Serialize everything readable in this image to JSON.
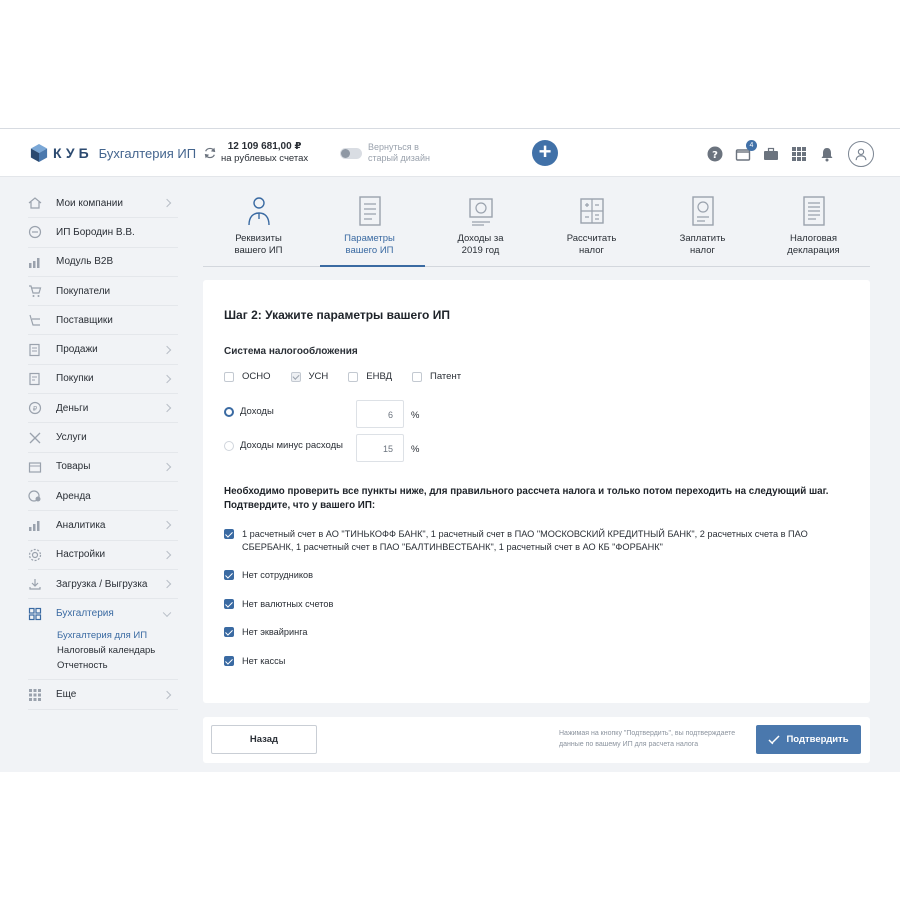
{
  "header": {
    "logo_text": "КУБ",
    "logo_sub": "Бухгалтерия ИП",
    "balance_amount": "12 109 681,00 ₽",
    "balance_label": "на рублевых счетах",
    "old_design_line1": "Вернуться в",
    "old_design_line2": "старый дизайн",
    "notifications_count": "4",
    "plus_label": "+"
  },
  "sidebar": {
    "items": [
      {
        "label": "Мои компании",
        "icon": "home-icon"
      },
      {
        "label": "ИП Бородин В.В.",
        "icon": "company-icon"
      },
      {
        "label": "Модуль B2B",
        "icon": "b2b-icon"
      },
      {
        "label": "Покупатели",
        "icon": "cart-icon"
      },
      {
        "label": "Поставщики",
        "icon": "supplier-icon"
      },
      {
        "label": "Продажи",
        "icon": "sales-icon"
      },
      {
        "label": "Покупки",
        "icon": "purchases-icon"
      },
      {
        "label": "Деньги",
        "icon": "money-icon"
      },
      {
        "label": "Услуги",
        "icon": "services-icon"
      },
      {
        "label": "Товары",
        "icon": "goods-icon"
      },
      {
        "label": "Аренда",
        "icon": "rent-icon"
      },
      {
        "label": "Аналитика",
        "icon": "analytics-icon"
      },
      {
        "label": "Настройки",
        "icon": "gear-icon"
      },
      {
        "label": "Загрузка / Выгрузка",
        "icon": "upload-icon"
      },
      {
        "label": "Бухгалтерия",
        "icon": "accounting-icon"
      },
      {
        "label": "Еще",
        "icon": "grid-icon"
      }
    ],
    "sub_items": [
      "Бухгалтерия для ИП",
      "Налоговый календарь",
      "Отчетность"
    ]
  },
  "steps": [
    {
      "line1": "Реквизиты",
      "line2": "вашего ИП"
    },
    {
      "line1": "Параметры",
      "line2": "вашего ИП"
    },
    {
      "line1": "Доходы за",
      "line2": "2019 год"
    },
    {
      "line1": "Рассчитать",
      "line2": "налог"
    },
    {
      "line1": "Заплатить",
      "line2": "налог"
    },
    {
      "line1": "Налоговая",
      "line2": "декларация"
    }
  ],
  "form": {
    "title": "Шаг 2: Укажите параметры вашего ИП",
    "tax_system_label": "Система налогообложения",
    "tax_options": [
      "ОСНО",
      "УСН",
      "ЕНВД",
      "Патент"
    ],
    "selected_tax": "УСН",
    "income_label": "Доходы",
    "income_rate": "6",
    "income_minus_label": "Доходы минус расходы",
    "income_minus_rate": "15",
    "percent": "%",
    "notice": "Необходимо проверить все пункты ниже, для правильного рассчета налога и только потом переходить на следующий шаг. Подтвердите, что у вашего ИП:",
    "checks": [
      "1 расчетный счет в АО \"ТИНЬКОФФ БАНК\", 1 расчетный счет в ПАО \"МОСКОВСКИЙ КРЕДИТНЫЙ БАНК\", 2 расчетных счета в ПАО СБЕРБАНК, 1 расчетный счет в ПАО \"БАЛТИНВЕСТБАНК\", 1 расчетный счет в АО КБ \"ФОРБАНК\"",
      "Нет сотрудников",
      "Нет валютных счетов",
      "Нет эквайринга",
      "Нет кассы"
    ]
  },
  "footer": {
    "back_label": "Назад",
    "note": "Нажимая на кнопку \"Подтвердить\", вы подтверждаете данные по вашему ИП для расчета налога",
    "confirm_label": "Подтвердить"
  },
  "colors": {
    "accent": "#3a6aa2",
    "button": "#4a78ad",
    "background": "#f1f3f6"
  }
}
